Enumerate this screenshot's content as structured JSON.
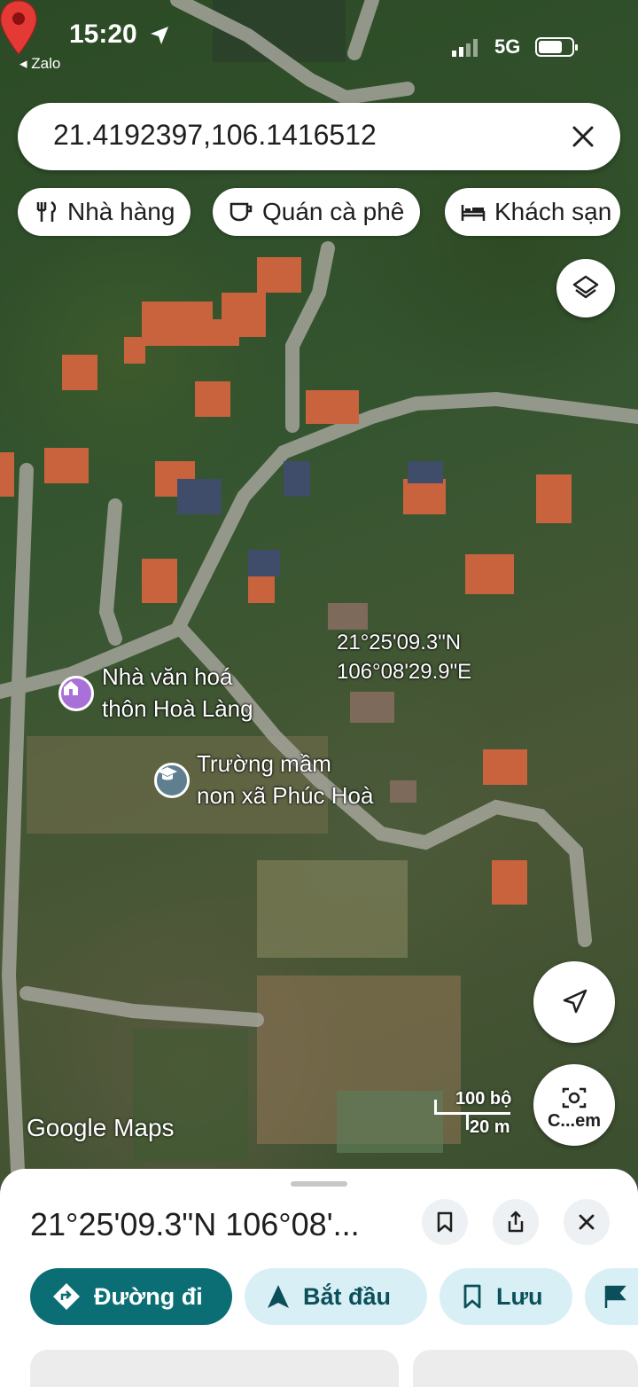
{
  "status_bar": {
    "time": "15:20",
    "back_app": "◂ Zalo",
    "network": "5G"
  },
  "search": {
    "value": "21.4192397,106.1416512",
    "clear_icon": "close-icon"
  },
  "chips": [
    {
      "label": "Nhà hàng",
      "icon": "restaurant-icon"
    },
    {
      "label": "Quán cà phê",
      "icon": "cafe-icon"
    },
    {
      "label": "Khách sạn",
      "icon": "hotel-icon"
    }
  ],
  "map": {
    "pin_label_lat": "21°25'09.3\"N",
    "pin_label_lng": "106°08'29.9\"E",
    "pois": [
      {
        "line1": "Nhà văn hoá",
        "line2": "thôn Hoà Làng",
        "icon": "community-center-icon",
        "color": "#a970d9"
      },
      {
        "line1": "Trường mầm",
        "line2": "non xã Phúc Hoà",
        "icon": "school-icon",
        "color": "#5f7f8f"
      }
    ],
    "logo": "Google Maps",
    "scale_top": "100 bộ",
    "scale_bottom": "20 m",
    "camera_label": "C...em"
  },
  "sheet": {
    "title": "21°25'09.3\"N 106°08'...",
    "actions": [
      {
        "label": "Đường đi",
        "icon": "directions-icon"
      },
      {
        "label": "Bắt đầu",
        "icon": "navigation-arrow-icon"
      },
      {
        "label": "Lưu",
        "icon": "bookmark-icon"
      }
    ]
  },
  "colors": {
    "primary": "#0b6e75",
    "secondary": "#d8f0f5",
    "pin": "#e53935"
  }
}
